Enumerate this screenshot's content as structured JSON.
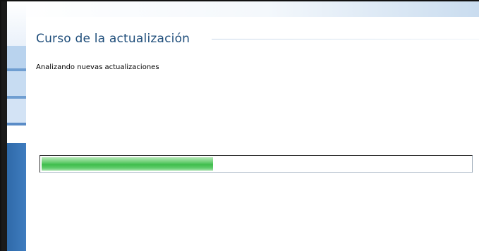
{
  "window": {
    "title": "Curso de la actualización",
    "status_text": "Analizando nuevas actualizaciones"
  },
  "progress": {
    "value_fraction": 0.4
  },
  "colors": {
    "title_color": "#1e4d7a",
    "progress_green": "#3fbd4c",
    "sidebar_blue": "#3f7cbf"
  }
}
